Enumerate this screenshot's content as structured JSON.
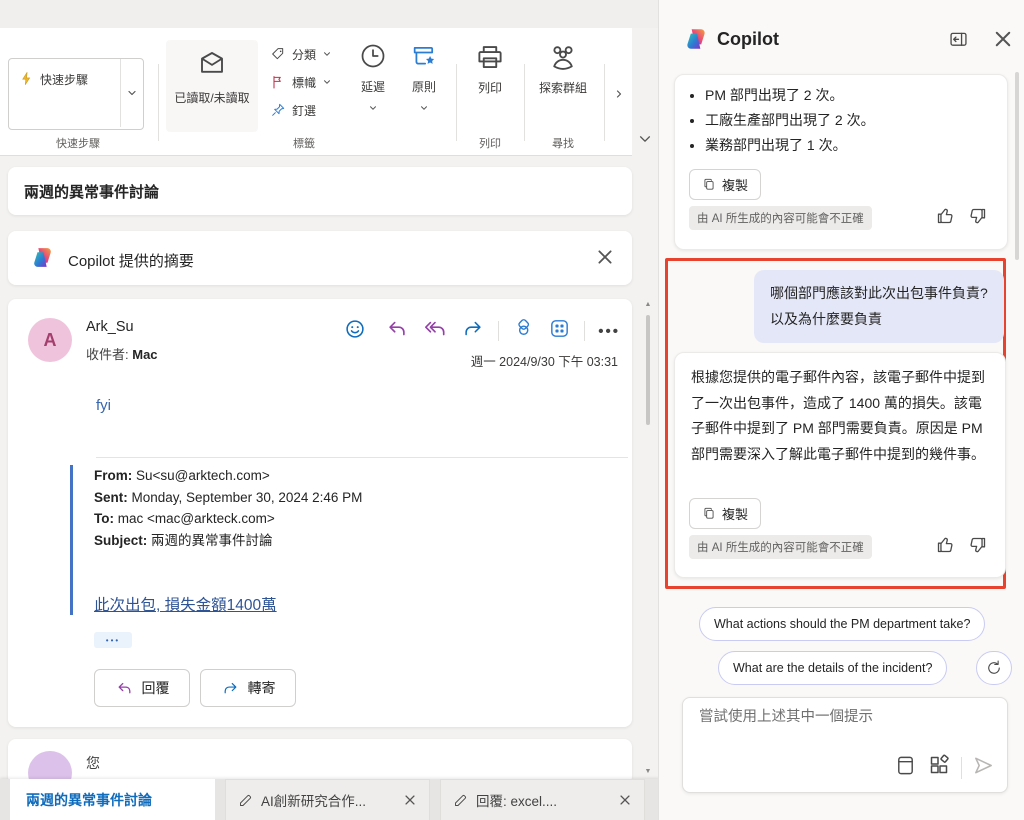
{
  "ribbon": {
    "quick_steps": {
      "label": "快速步驟",
      "group": "快速步驟"
    },
    "read_unread": "已讀取/未讀取",
    "categorize": "分類",
    "flag": "標幟",
    "pin": "釘選",
    "tags_group": "標籤",
    "snooze": "延遲",
    "policy": "原則",
    "print_label": "列印",
    "print_group": "列印",
    "groups_label": "探索群組",
    "find_group": "尋找"
  },
  "email": {
    "subject": "兩週的異常事件討論",
    "summary_banner": "Copilot 提供的摘要",
    "sender": "Ark_Su",
    "avatar_letter": "A",
    "to_label": "收件者:",
    "to": "Mac",
    "date": "週一 2024/9/30 下午 03:31",
    "body_intro": "fyi",
    "quote": {
      "from_label": "From:",
      "from": "Su<su@arktech.com>",
      "sent_label": "Sent:",
      "sent": "Monday, September 30, 2024 2:46 PM",
      "to_label": "To:",
      "to": "mac <mac@arkteck.com>",
      "subject_label": "Subject:",
      "subject": "兩週的異常事件討論",
      "highlight": "此次出包, 損失金額1400萬"
    },
    "ellipsis": "•••",
    "reply_label": "回覆",
    "forward_label": "轉寄",
    "you_label": "您",
    "you_avatar_letter": ""
  },
  "tabs": [
    {
      "label": "兩週的異常事件討論",
      "active": true
    },
    {
      "label": "AI創新研究合作...",
      "active": false
    },
    {
      "label": "回覆: excel....",
      "active": false
    }
  ],
  "copilot": {
    "title": "Copilot",
    "message1_bullets": [
      "PM 部門出現了 2 次。",
      "工廠生產部門出現了 2 次。",
      "業務部門出現了 1 次。"
    ],
    "copy_label": "複製",
    "disclaimer": "由 AI 所生成的內容可能會不正確",
    "user_question": "哪個部門應該對此次出包事件負責? 以及為什麼要負責",
    "answer": "根據您提供的電子郵件內容，該電子郵件中提到了一次出包事件，造成了 1400 萬的損失。該電子郵件中提到了 PM 部門需要負責。原因是 PM 部門需要深入了解此電子郵件中提到的幾件事。",
    "suggestions": [
      "What actions should the PM department take?",
      "What are the details of the incident?"
    ],
    "input_placeholder": "嘗試使用上述其中一個提示"
  },
  "icons": {
    "ellipsis_more": "•••",
    "scroll_up": "▲",
    "scroll_down": "▼"
  },
  "colors": {
    "accent_blue": "#0f6cbd",
    "annotation_red": "#e8432e",
    "link_blue": "#2f5496",
    "user_bubble": "#e4e7f8"
  }
}
